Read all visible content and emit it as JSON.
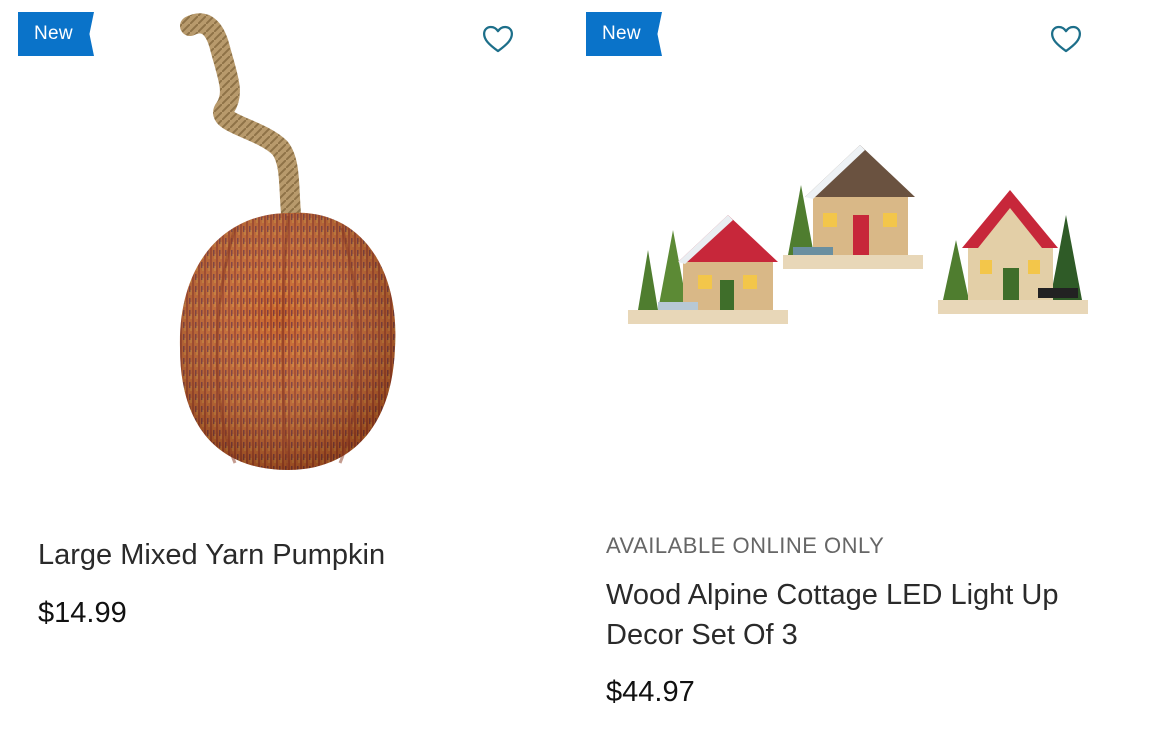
{
  "products": [
    {
      "badge": "New",
      "eyebrow": "",
      "title": "Large Mixed Yarn Pumpkin",
      "price": "$14.99",
      "wishlist_icon": "heart-outline-icon"
    },
    {
      "badge": "New",
      "eyebrow": "AVAILABLE ONLINE ONLY",
      "title": "Wood Alpine Cottage LED Light Up Decor Set Of 3",
      "price": "$44.97",
      "wishlist_icon": "heart-outline-icon"
    }
  ],
  "colors": {
    "badge_bg": "#0a73c9",
    "heart_stroke": "#1d6f8a",
    "price_text": "#111111",
    "eyebrow_text": "#666666"
  }
}
